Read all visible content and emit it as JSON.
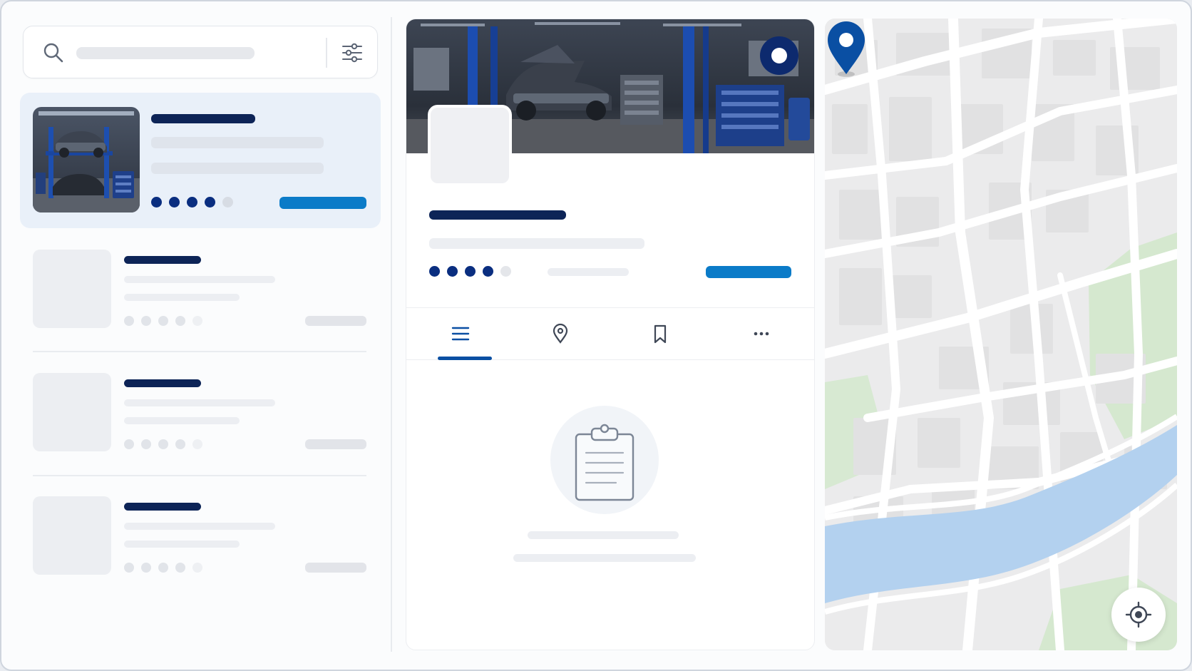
{
  "icons": {
    "search": "search-icon",
    "filter": "sliders-icon",
    "tabs": [
      "list-icon",
      "map-pin-icon",
      "bookmark-icon",
      "more-horizontal-icon"
    ],
    "empty_state": "clipboard-icon",
    "locate": "crosshair-icon",
    "map_marker": "map-pin-icon"
  },
  "colors": {
    "primary_navy": "#0d2457",
    "accent_blue": "#0b7bc8",
    "rating_dot": "#0a2e80",
    "pin": "#0a4fa3",
    "water": "#b3d1ef",
    "park": "#d8ead1",
    "active_card": "#e9f0f9"
  },
  "list": {
    "items": [
      {
        "state": "selected",
        "rating": 4,
        "rating_max": 5
      },
      {
        "state": "loading",
        "rating": 4,
        "rating_max": 5
      },
      {
        "state": "loading",
        "rating": 4,
        "rating_max": 5
      },
      {
        "state": "loading",
        "rating": 4,
        "rating_max": 5
      }
    ]
  },
  "detail": {
    "rating": 4,
    "rating_max": 5,
    "active_tab": 0
  }
}
